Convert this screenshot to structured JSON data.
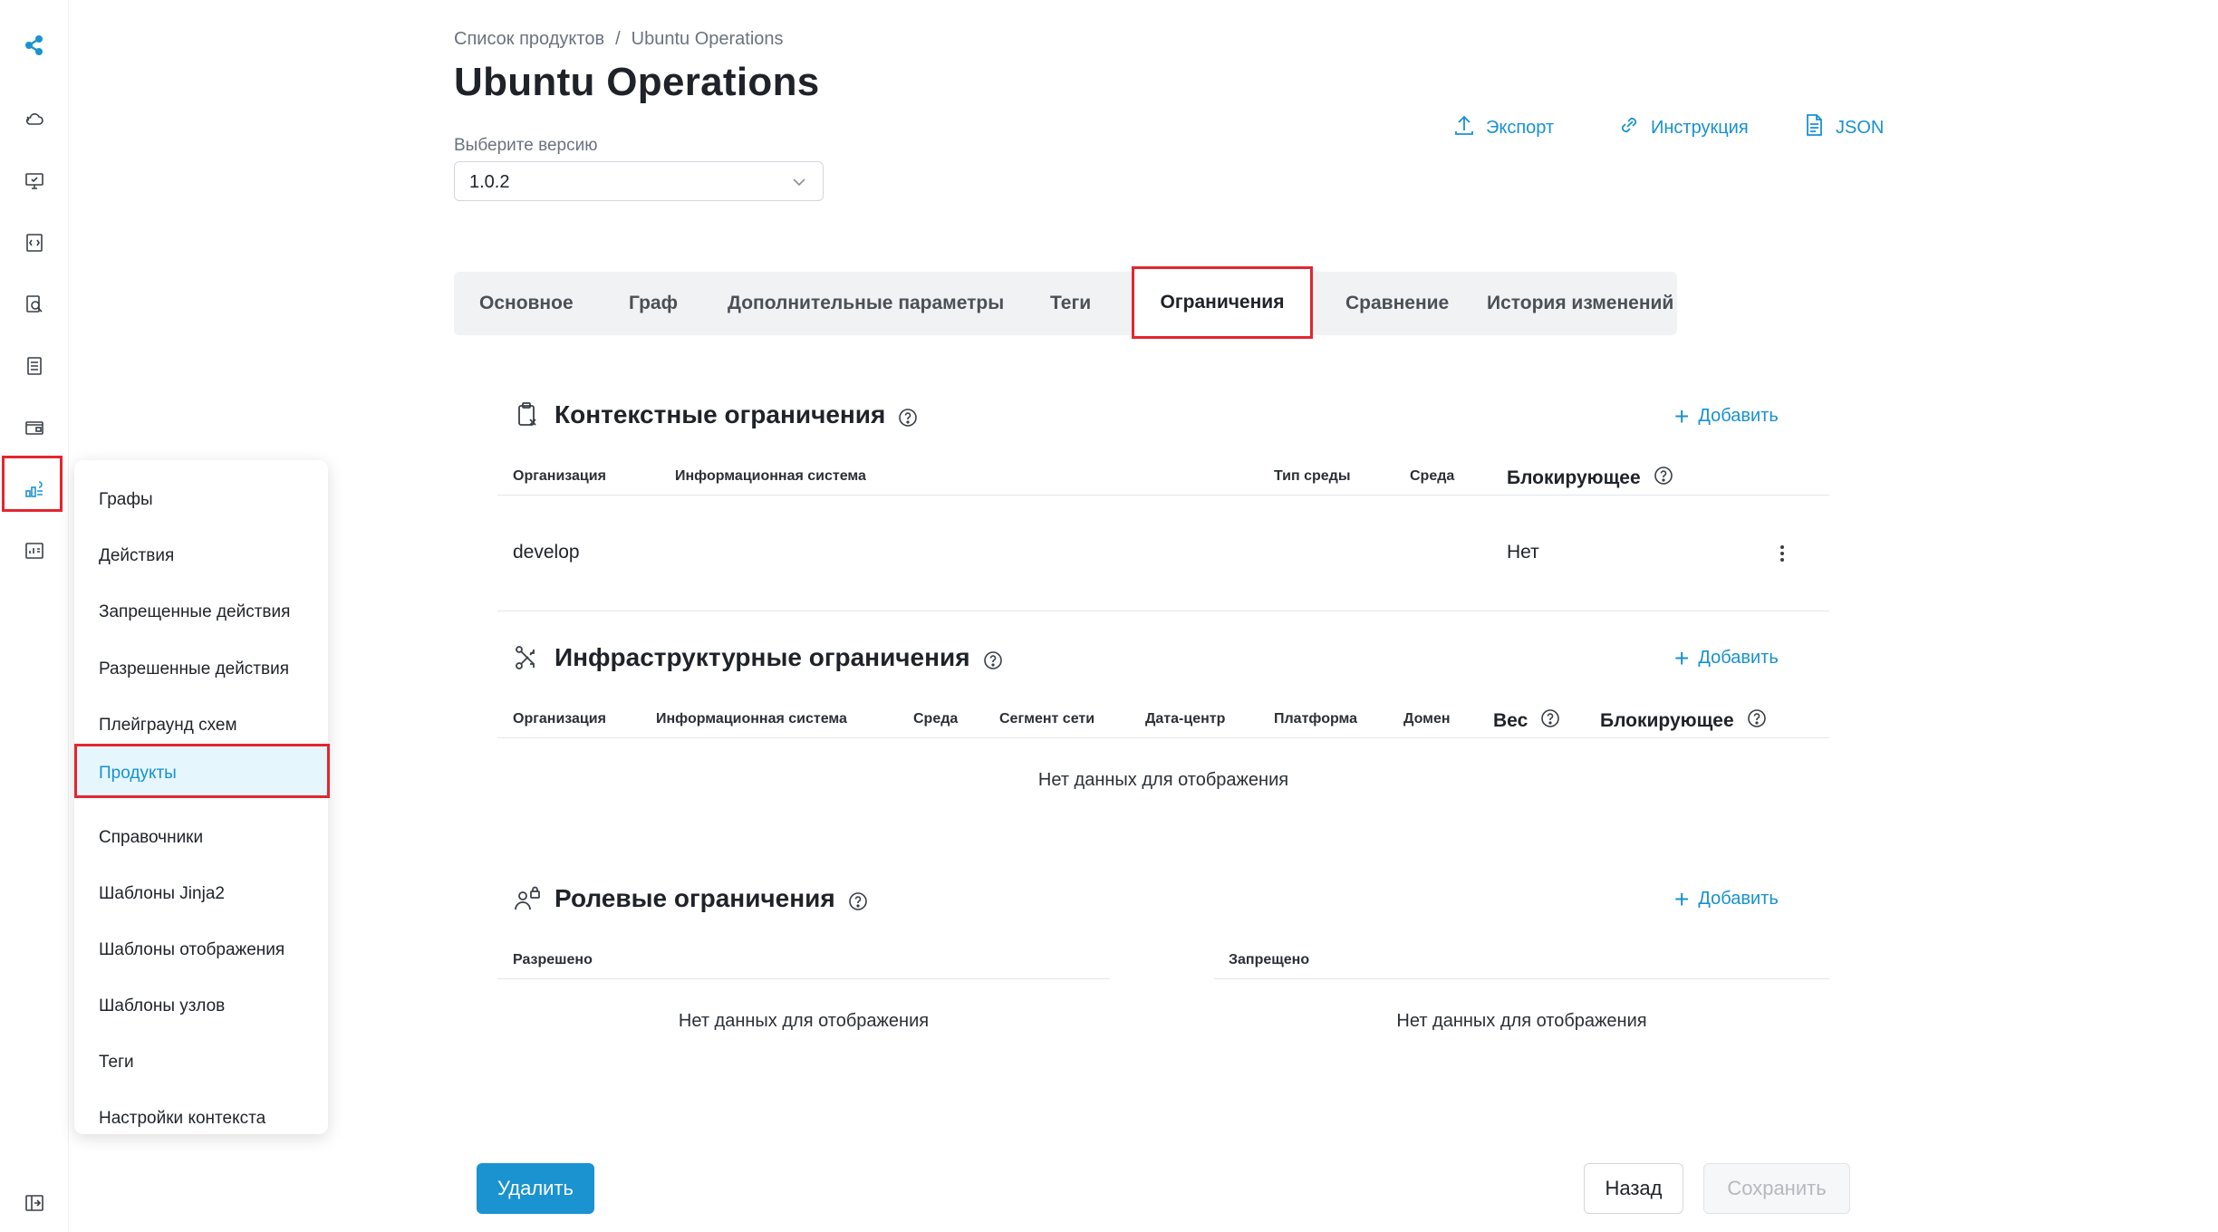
{
  "breadcrumb": {
    "parent": "Список продуктов",
    "separator": "/",
    "current": "Ubuntu Operations"
  },
  "page": {
    "title": "Ubuntu Operations"
  },
  "version": {
    "label": "Выберите версию",
    "value": "1.0.2"
  },
  "header_actions": {
    "export": "Экспорт",
    "instruction": "Инструкция",
    "json": "JSON"
  },
  "tabs": [
    {
      "label": "Основное"
    },
    {
      "label": "Граф"
    },
    {
      "label": "Дополнительные параметры"
    },
    {
      "label": "Теги"
    },
    {
      "label": "Ограничения",
      "active": true
    },
    {
      "label": "Сравнение"
    },
    {
      "label": "История изменений"
    }
  ],
  "menu": {
    "items": [
      {
        "label": "Графы"
      },
      {
        "label": "Действия"
      },
      {
        "label": "Запрещенные действия"
      },
      {
        "label": "Разрешенные действия"
      },
      {
        "label": "Плейграунд схем"
      },
      {
        "label": "Продукты",
        "active": true
      },
      {
        "label": "Справочники"
      },
      {
        "label": "Шаблоны Jinja2"
      },
      {
        "label": "Шаблоны отображения"
      },
      {
        "label": "Шаблоны узлов"
      },
      {
        "label": "Теги"
      },
      {
        "label": "Настройки контекста"
      }
    ]
  },
  "context": {
    "title": "Контекстные ограничения",
    "add_label": "Добавить",
    "columns": [
      "Организация",
      "Информационная система",
      "Тип среды",
      "Среда",
      "Блокирующее"
    ],
    "rows": [
      {
        "organization": "develop",
        "blocking": "Нет"
      }
    ]
  },
  "infra": {
    "title": "Инфраструктурные ограничения",
    "add_label": "Добавить",
    "columns": [
      "Организация",
      "Информационная система",
      "Среда",
      "Сегмент сети",
      "Дата-центр",
      "Платформа",
      "Домен",
      "Вес",
      "Блокирующее"
    ],
    "empty": "Нет данных для отображения"
  },
  "roles": {
    "title": "Ролевые ограничения",
    "add_label": "Добавить",
    "allowed_label": "Разрешено",
    "forbidden_label": "Запрещено",
    "empty_allowed": "Нет данных для отображения",
    "empty_forbidden": "Нет данных для отображения"
  },
  "footer": {
    "delete": "Удалить",
    "back": "Назад",
    "save": "Сохранить"
  },
  "colors": {
    "accent": "#1891d0",
    "highlight": "#e3262f",
    "primary_button": "#1a93d0"
  },
  "icons": [
    "app-logo-icon",
    "cloud-icon",
    "monitor-icon",
    "code-file-icon",
    "search-doc-icon",
    "list-icon",
    "wallet-icon",
    "schema-icon",
    "dashboard-icon",
    "expand-icon"
  ]
}
